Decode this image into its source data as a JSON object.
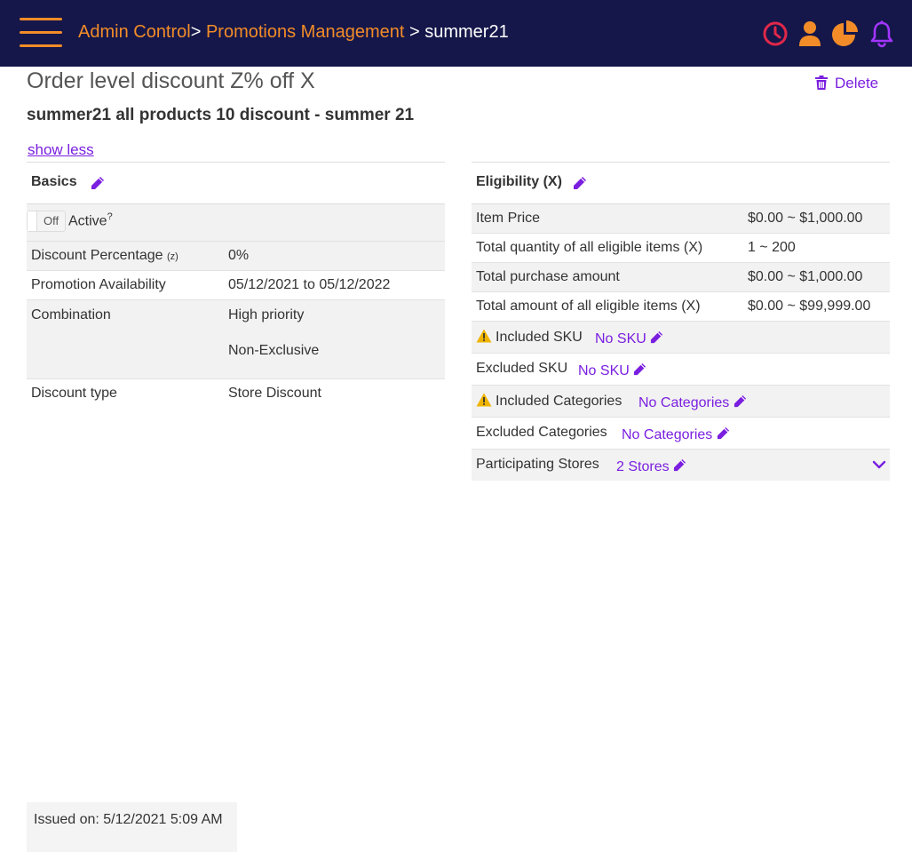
{
  "header": {
    "breadcrumb": {
      "admin": "Admin Control",
      "sep1": ">",
      "promotions": "Promotions Management",
      "sep2": ">",
      "current": "summer21"
    },
    "icons": [
      "clock-icon",
      "user-icon",
      "pie-chart-icon",
      "bell-icon"
    ],
    "colors": {
      "bar": "#15174a",
      "accent": "#f28c28",
      "clock": "#e0284a",
      "bell": "#a335ff"
    }
  },
  "page": {
    "title": "Order level discount Z% off X",
    "delete_label": "Delete",
    "subtitle": "summer21 all products 10 discount - summer 21",
    "show_less": "show less"
  },
  "basics": {
    "title": "Basics",
    "active": {
      "toggle": "Off",
      "label": "Active",
      "help": "?"
    },
    "discount_percentage": {
      "label": "Discount Percentage",
      "hint": "(z)",
      "value": "0%"
    },
    "availability": {
      "label": "Promotion Availability",
      "value": "05/12/2021 to 05/12/2022"
    },
    "combination": {
      "label": "Combination",
      "value1": "High priority",
      "value2": "Non-Exclusive"
    },
    "discount_type": {
      "label": "Discount type",
      "value": "Store Discount"
    }
  },
  "eligibility": {
    "title": "Eligibility (X)",
    "item_price": {
      "label": "Item Price",
      "value": "$0.00 ~ $1,000.00"
    },
    "total_qty": {
      "label": "Total quantity of all eligible items (X)",
      "value": "1 ~ 200"
    },
    "total_purchase": {
      "label": "Total purchase amount",
      "value": "$0.00 ~ $1,000.00"
    },
    "total_amount": {
      "label": "Total amount of all eligible items (X)",
      "value": "$0.00 ~ $99,999.00"
    },
    "included_sku": {
      "label": "Included SKU",
      "link": "No SKU"
    },
    "excluded_sku": {
      "label": "Excluded SKU",
      "link": "No SKU"
    },
    "included_categories": {
      "label": "Included Categories",
      "link": "No Categories"
    },
    "excluded_categories": {
      "label": "Excluded Categories",
      "link": "No Categories"
    },
    "stores": {
      "label": "Participating Stores",
      "link": "2 Stores"
    }
  },
  "footer": {
    "issued": "Issued on: 5/12/2021 5:09 AM"
  }
}
